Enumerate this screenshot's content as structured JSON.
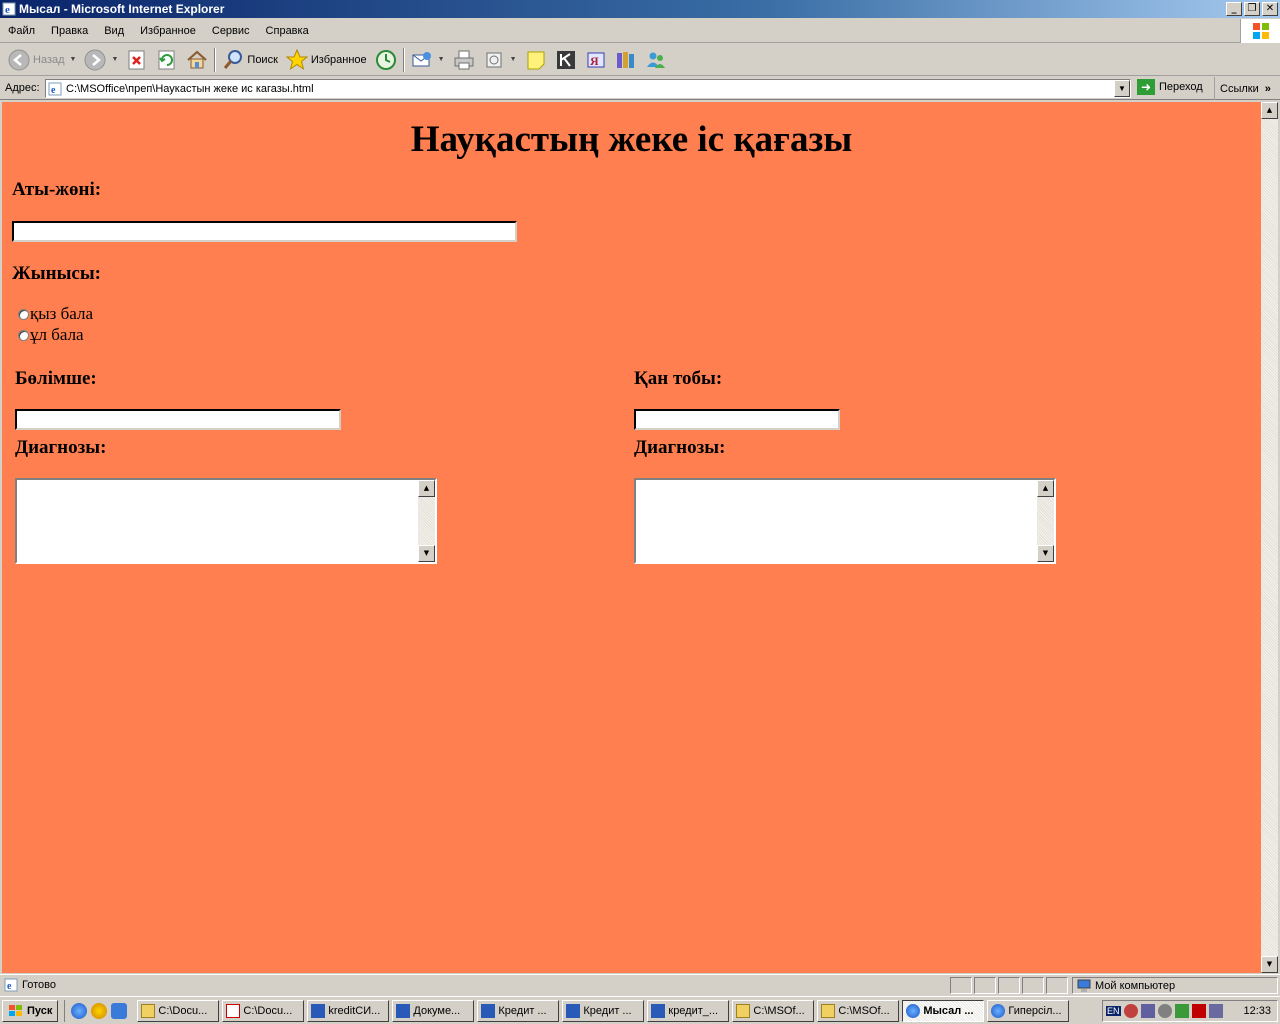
{
  "window": {
    "title": "Мысал - Microsoft Internet Explorer",
    "controls": [
      "_",
      "❐",
      "✕"
    ]
  },
  "menu": [
    "Файл",
    "Правка",
    "Вид",
    "Избранное",
    "Сервис",
    "Справка"
  ],
  "toolbar": {
    "back": "Назад",
    "search": "Поиск",
    "favorites": "Избранное"
  },
  "address": {
    "label": "Адрес:",
    "url": "C:\\MSOffice\\преп\\Наукастын жеке ис кагазы.html",
    "go": "Переход",
    "links": "Ссылки"
  },
  "page": {
    "title": "Науқастың жеке іс қағазы",
    "name_label": "Аты-жөні:",
    "name_value": "",
    "gender_label": "Жынысы:",
    "gender_options": [
      "қыз бала",
      "ұл бала"
    ],
    "department_label": "Бөлімше:",
    "department_value": "",
    "blood_label": "Қан тобы:",
    "blood_value": "",
    "diagnosis_left_label": "Диагнозы:",
    "diagnosis_right_label": "Диагнозы:",
    "background_color": "#ff7f50"
  },
  "status": {
    "text": "Готово",
    "zone": "Мой компьютер"
  },
  "taskbar": {
    "start": "Пуск",
    "tasks": [
      {
        "label": "C:\\Docu...",
        "icon": "folder-icon"
      },
      {
        "label": "C:\\Docu...",
        "icon": "acrobat-icon"
      },
      {
        "label": "kreditCИ...",
        "icon": "word-icon"
      },
      {
        "label": "Докуме...",
        "icon": "word-icon"
      },
      {
        "label": "Кредит ...",
        "icon": "word-icon"
      },
      {
        "label": "Кредит ...",
        "icon": "word-icon"
      },
      {
        "label": "кредит_...",
        "icon": "word-icon"
      },
      {
        "label": "C:\\MSOf...",
        "icon": "folder-icon"
      },
      {
        "label": "C:\\MSOf...",
        "icon": "folder-icon"
      },
      {
        "label": "Мысал ...",
        "icon": "ie-icon",
        "active": true
      },
      {
        "label": "Гиперсіл...",
        "icon": "ie-icon"
      }
    ],
    "lang": "EN",
    "clock": "12:33"
  }
}
